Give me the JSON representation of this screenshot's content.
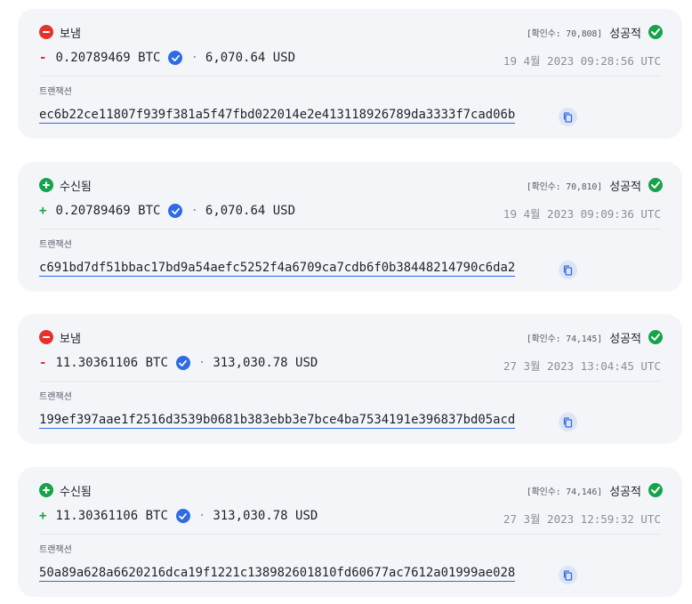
{
  "transactions": [
    {
      "direction": "sent",
      "direction_label": "보냄",
      "confirmations": "[확인수: 70,808]",
      "status": "성공적",
      "sign": "-",
      "amount": "0.20789469 BTC",
      "fiat": "6,070.64 USD",
      "timestamp": "19 4월 2023 09:28:56 UTC",
      "tx_label": "트랜잭션",
      "hash": "ec6b22ce11807f939f381a5f47fbd022014e2e413118926789da3333f7cad06b"
    },
    {
      "direction": "received",
      "direction_label": "수신됨",
      "confirmations": "[확인수: 70,810]",
      "status": "성공적",
      "sign": "+",
      "amount": "0.20789469 BTC",
      "fiat": "6,070.64 USD",
      "timestamp": "19 4월 2023 09:09:36 UTC",
      "tx_label": "트랜잭션",
      "hash": "c691bd7df51bbac17bd9a54aefc5252f4a6709ca7cdb6f0b38448214790c6da2"
    },
    {
      "direction": "sent",
      "direction_label": "보냄",
      "confirmations": "[확인수: 74,145]",
      "status": "성공적",
      "sign": "-",
      "amount": "11.30361106 BTC",
      "fiat": "313,030.78 USD",
      "timestamp": "27 3월 2023 13:04:45 UTC",
      "tx_label": "트랜잭션",
      "hash": "199ef397aae1f2516d3539b0681b383ebb3e7bce4ba7534191e396837bd05acd"
    },
    {
      "direction": "received",
      "direction_label": "수신됨",
      "confirmations": "[확인수: 74,146]",
      "status": "성공적",
      "sign": "+",
      "amount": "11.30361106 BTC",
      "fiat": "313,030.78 USD",
      "timestamp": "27 3월 2023 12:59:32 UTC",
      "tx_label": "트랜잭션",
      "hash": "50a89a628a6620216dca19f1221c138982601810fd60677ac7612a01999ae028"
    }
  ],
  "icons": {
    "sent": "minus-circle-icon",
    "received": "plus-circle-icon",
    "status": "check-circle-icon",
    "verified": "verified-badge-icon",
    "copy": "copy-icon"
  },
  "colors": {
    "sent": "#e5322d",
    "received": "#16a34a",
    "success": "#16a34a",
    "link": "#2e6be6",
    "card_bg": "#f3f5f9"
  }
}
